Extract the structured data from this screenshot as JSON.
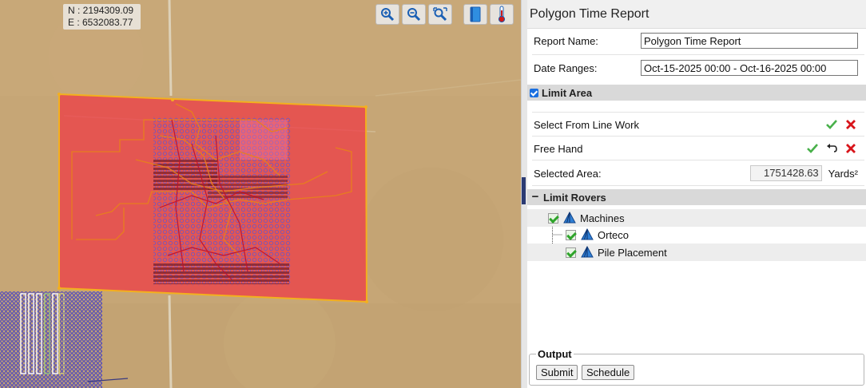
{
  "map": {
    "coords": {
      "north": "N : 2194309.09",
      "east": "E : 6532083.77"
    },
    "tools": [
      {
        "name": "zoom-in-icon"
      },
      {
        "name": "zoom-out-icon"
      },
      {
        "name": "zoom-extents-icon"
      },
      {
        "name": "map-book-icon"
      },
      {
        "name": "thermometer-icon"
      }
    ],
    "colors": {
      "terrain": "#c8a977",
      "area_fill": "#ee3b45",
      "area_stroke": "#f3b01e",
      "track": "#e8801c",
      "rover_line": "#c0102a",
      "points": "#4040c8"
    }
  },
  "panel": {
    "title": "Polygon Time Report",
    "report_name": {
      "label": "Report Name:",
      "value": "Polygon Time Report"
    },
    "date_ranges": {
      "label": "Date Ranges:",
      "value": "Oct-15-2025 00:00 - Oct-16-2025 00:00"
    },
    "limit_area": {
      "title": "Limit Area",
      "checked": true,
      "select_from_line_work": "Select From Line Work",
      "free_hand": "Free Hand",
      "selected_area": {
        "label": "Selected Area:",
        "value": "1751428.63",
        "unit": "Yards²"
      }
    },
    "limit_rovers": {
      "title": "Limit Rovers",
      "tree": [
        {
          "label": "Machines",
          "level": 0
        },
        {
          "label": "Orteco",
          "level": 1
        },
        {
          "label": "Pile Placement",
          "level": 1
        }
      ]
    },
    "output": {
      "legend": "Output",
      "submit": "Submit",
      "schedule": "Schedule"
    }
  }
}
